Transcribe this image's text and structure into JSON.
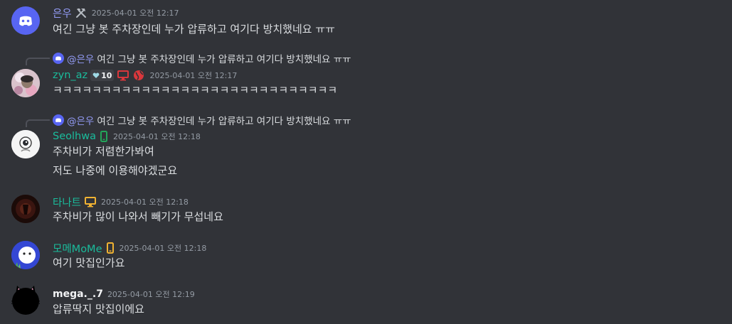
{
  "messages": [
    {
      "username": "은우",
      "username_color": "#949cf7",
      "role_icon": "hammer-pick-icon",
      "timestamp": "2025-04-01 오전 12:17",
      "lines": [
        "여긴 그냥 봇 주차장인데 누가 압류하고 여기다 방치했네요 ㅠㅠ"
      ]
    },
    {
      "reply": {
        "mention": "@은우",
        "text": "여긴 그냥 봇 주차장인데 누가 압류하고 여기다 방치했네요 ㅠㅠ"
      },
      "username": "zyn_az",
      "username_color": "#1abc9c",
      "clan_tag": "10",
      "status_icons": [
        "monitor-icon",
        "globe-icon"
      ],
      "timestamp": "2025-04-01 오전 12:17",
      "lines": [
        "ㅋㅋㅋㅋㅋㅋㅋㅋㅋㅋㅋㅋㅋㅋㅋㅋㅋㅋㅋㅋㅋㅋㅋㅋㅋㅋㅋㅋㅋ"
      ]
    },
    {
      "reply": {
        "mention": "@은우",
        "text": "여긴 그냥 봇 주차장인데 누가 압류하고 여기다 방치했네요 ㅠㅠ"
      },
      "username": "Seolhwa",
      "username_color": "#1abc9c",
      "status_icons": [
        "mobile-icon"
      ],
      "timestamp": "2025-04-01 오전 12:18",
      "lines": [
        "주차비가 저렴한가봐여",
        "저도 나중에 이용해야겠군요"
      ]
    },
    {
      "username": "타나트",
      "username_color": "#1abc9c",
      "status_icons": [
        "monitor-icon"
      ],
      "timestamp": "2025-04-01 오전 12:18",
      "lines": [
        "주차비가 많이 나와서 빼기가 무섭네요"
      ]
    },
    {
      "username": "모메MoMe",
      "username_color": "#1abc9c",
      "status_icons": [
        "mobile-icon"
      ],
      "timestamp": "2025-04-01 오전 12:18",
      "lines": [
        "여기 맛집인가요"
      ]
    },
    {
      "username": "mega._.7",
      "username_color": "#f2f3f5",
      "timestamp": "2025-04-01 오전 12:19",
      "lines": [
        "압류딱지 맛집이에요"
      ]
    }
  ]
}
